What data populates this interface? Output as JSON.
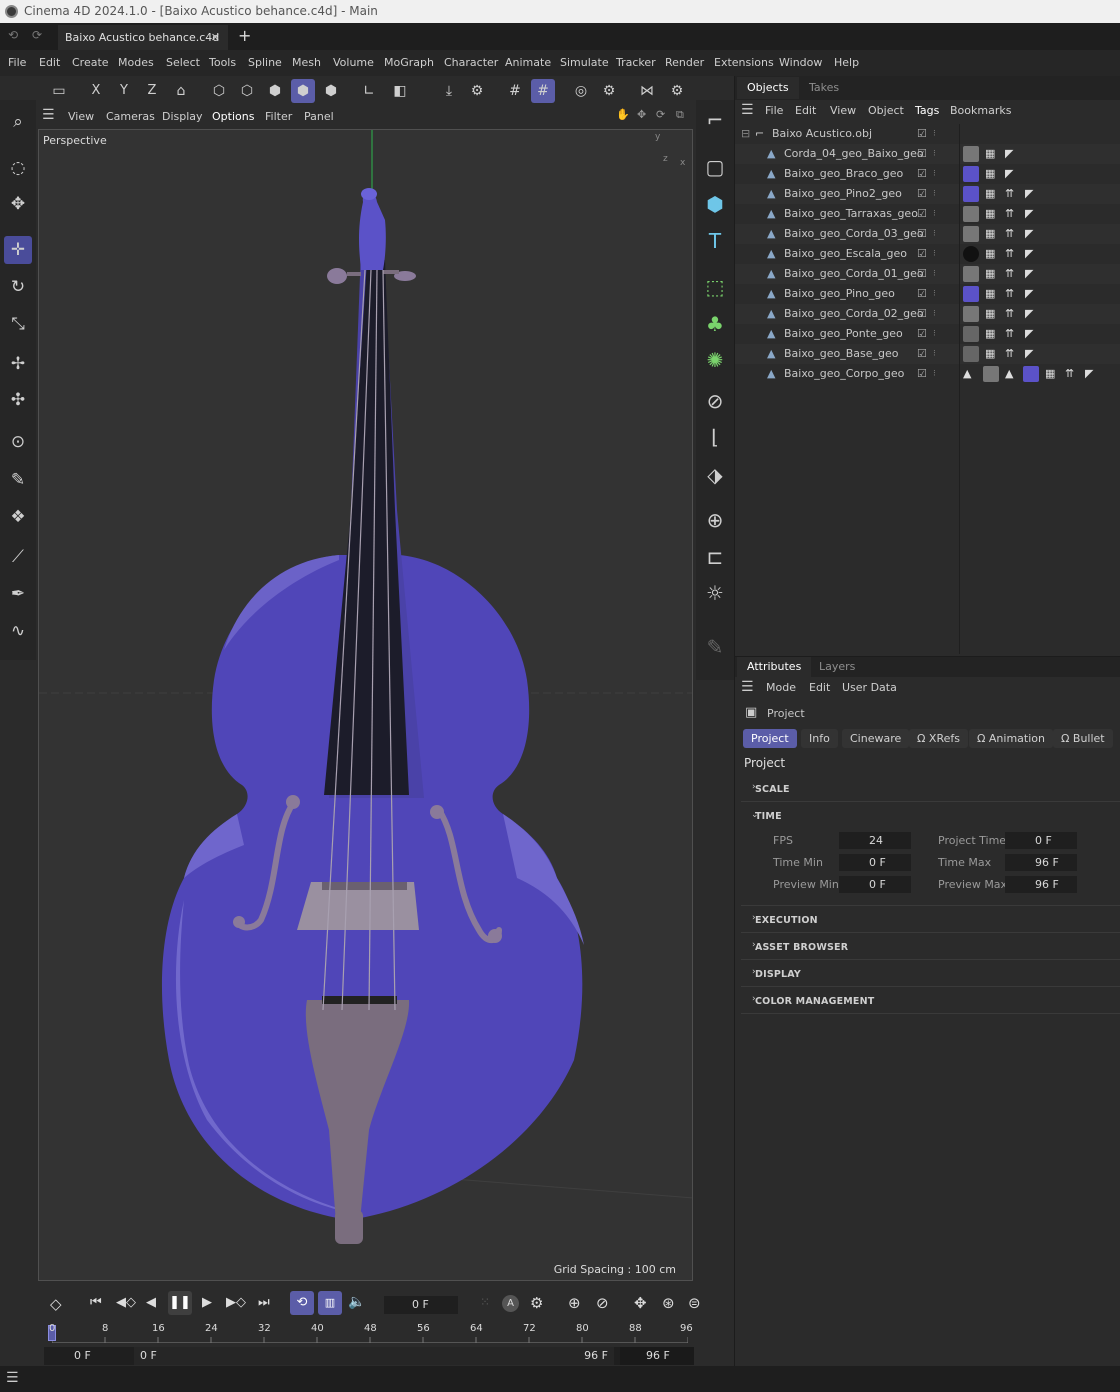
{
  "app": {
    "title": "Cinema 4D 2024.1.0 - [Baixo Acustico behance.c4d] - Main",
    "doc_tab": "Baixo Acustico behance.c4d"
  },
  "menu": [
    "File",
    "Edit",
    "Create",
    "Modes",
    "Select",
    "Tools",
    "Spline",
    "Mesh",
    "Volume",
    "MoGraph",
    "Character",
    "Animate",
    "Simulate",
    "Tracker",
    "Render",
    "Extensions",
    "Window",
    "Help"
  ],
  "toolbar": {
    "axis_x": "X",
    "axis_y": "Y",
    "axis_z": "Z"
  },
  "viewport": {
    "menu": [
      "View",
      "Cameras",
      "Display",
      "Options",
      "Filter",
      "Panel"
    ],
    "camera_label": "Perspective",
    "grid_spacing": "Grid Spacing : 100 cm",
    "axis_y": "y",
    "axis_x": "x",
    "axis_z": "z"
  },
  "objects": {
    "tabs": [
      "Objects",
      "Takes"
    ],
    "menu": [
      "File",
      "Edit",
      "View",
      "Object",
      "Tags",
      "Bookmarks"
    ],
    "root": "Baixo Acustico.obj",
    "items": [
      "Corda_04_geo_Baixo_geo",
      "Baixo_geo_Braco_geo",
      "Baixo_geo_Pino2_geo",
      "Baixo_geo_Tarraxas_geo",
      "Baixo_geo_Corda_03_geo",
      "Baixo_geo_Escala_geo",
      "Baixo_geo_Corda_01_geo",
      "Baixo_geo_Pino_geo",
      "Baixo_geo_Corda_02_geo",
      "Baixo_geo_Ponte_geo",
      "Baixo_geo_Base_geo",
      "Baixo_geo_Corpo_geo"
    ]
  },
  "attributes": {
    "tabs": [
      "Attributes",
      "Layers"
    ],
    "menu": [
      "Mode",
      "Edit",
      "User Data"
    ],
    "object": "Project",
    "subtabs": [
      "Project",
      "Info",
      "Cineware",
      "XRefs",
      "Animation",
      "Bullet"
    ],
    "heading": "Project",
    "sections": {
      "scale": "SCALE",
      "time": "TIME",
      "execution": "EXECUTION",
      "asset_browser": "ASSET BROWSER",
      "display": "DISPLAY",
      "color_management": "COLOR MANAGEMENT"
    },
    "fields": {
      "fps": {
        "label": "FPS",
        "value": "24"
      },
      "project_time": {
        "label": "Project Time",
        "value": "0 F"
      },
      "time_min": {
        "label": "Time Min",
        "value": "0 F"
      },
      "time_max": {
        "label": "Time Max",
        "value": "96 F"
      },
      "preview_min": {
        "label": "Preview Min",
        "value": "0 F"
      },
      "preview_max": {
        "label": "Preview Max",
        "value": "96 F"
      }
    }
  },
  "timeline": {
    "current_frame": "0 F",
    "ticks": [
      "0",
      "8",
      "16",
      "24",
      "32",
      "40",
      "48",
      "56",
      "64",
      "72",
      "80",
      "88",
      "96"
    ],
    "range_start": "0 F",
    "preview_start": "0 F",
    "range_end": "96 F",
    "preview_end": "96 F"
  },
  "colors": {
    "accent": "#5b5da8",
    "body": "#5046b8"
  }
}
